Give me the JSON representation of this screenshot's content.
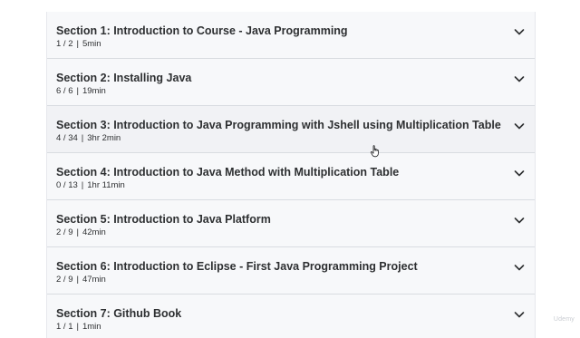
{
  "sections": [
    {
      "title": "Section 1: Introduction to Course - Java Programming",
      "progress": "1 / 2",
      "duration": "5min"
    },
    {
      "title": "Section 2: Installing Java",
      "progress": "6 / 6",
      "duration": "19min"
    },
    {
      "title": "Section 3: Introduction to Java Programming with Jshell using Multiplication Table",
      "progress": "4 / 34",
      "duration": "3hr 2min"
    },
    {
      "title": "Section 4: Introduction to Java Method with Multiplication Table",
      "progress": "0 / 13",
      "duration": "1hr 11min"
    },
    {
      "title": "Section 5: Introduction to Java Platform",
      "progress": "2 / 9",
      "duration": "42min"
    },
    {
      "title": "Section 6: Introduction to Eclipse - First Java Programming Project",
      "progress": "2 / 9",
      "duration": "47min"
    },
    {
      "title": "Section 7: Github Book",
      "progress": "1 / 1",
      "duration": "1min"
    }
  ],
  "separator": "|",
  "icons": {
    "toggle": "chevron-down-icon",
    "pointer": "hand-pointer-icon"
  },
  "watermark": "Udemy",
  "colors": {
    "panel_bg": "#f7f8fa",
    "text": "#2d2f31",
    "divider": "#d9dce1"
  }
}
